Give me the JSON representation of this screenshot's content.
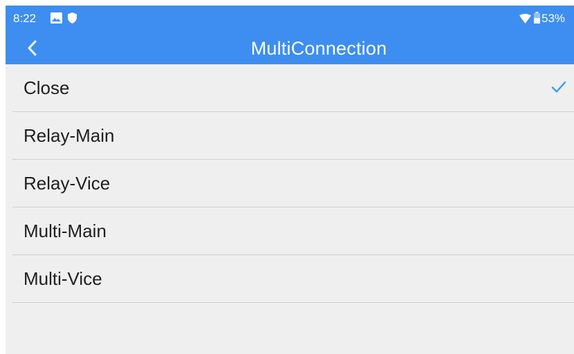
{
  "status_bar": {
    "time": "8:22",
    "battery_percent_text": "53%",
    "icons": [
      "gallery-icon",
      "shield-icon",
      "wifi-icon",
      "battery-icon"
    ],
    "background_color": "#3d8ef0"
  },
  "app_bar": {
    "title": "MultiConnection",
    "back_icon": "chevron-left-icon",
    "background_color": "#3d8ef0"
  },
  "options": [
    {
      "label": "Close",
      "selected": true
    },
    {
      "label": "Relay-Main",
      "selected": false
    },
    {
      "label": "Relay-Vice",
      "selected": false
    },
    {
      "label": "Multi-Main",
      "selected": false
    },
    {
      "label": "Multi-Vice",
      "selected": false
    }
  ],
  "colors": {
    "accent": "#3d8ef0",
    "check": "#3a9bf2",
    "list_background": "#efefef"
  }
}
